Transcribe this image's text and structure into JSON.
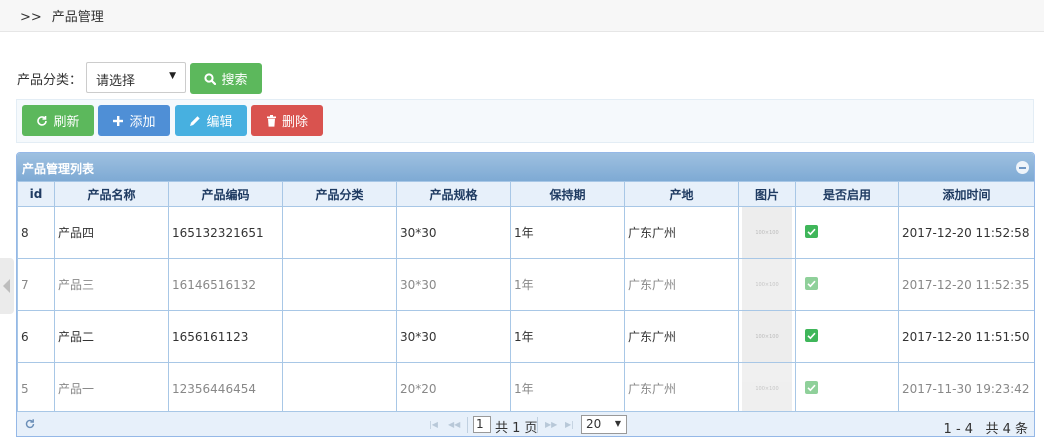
{
  "breadcrumb": {
    "prefix": ">>",
    "current": "产品管理"
  },
  "filter": {
    "label": "产品分类：",
    "select_value": "请选择",
    "search_label": "搜索"
  },
  "toolbar": {
    "refresh": "刷新",
    "add": "添加",
    "edit": "编辑",
    "delete": "删除"
  },
  "grid": {
    "title": "产品管理列表",
    "columns": [
      "id",
      "产品名称",
      "产品编码",
      "产品分类",
      "产品规格",
      "保持期",
      "产地",
      "图片",
      "是否启用",
      "添加时间"
    ],
    "rows": [
      {
        "id": "8",
        "name": "产品四",
        "code": "165132321651",
        "category": "",
        "spec": "30*30",
        "shelf": "1年",
        "origin": "广东广州",
        "image": "100×100",
        "enabled": true,
        "time": "2017-12-20 11:52:58"
      },
      {
        "id": "7",
        "name": "产品三",
        "code": "16146516132",
        "category": "",
        "spec": "30*30",
        "shelf": "1年",
        "origin": "广东广州",
        "image": "100×100",
        "enabled": true,
        "time": "2017-12-20 11:52:35"
      },
      {
        "id": "6",
        "name": "产品二",
        "code": "1656161123",
        "category": "",
        "spec": "30*30",
        "shelf": "1年",
        "origin": "广东广州",
        "image": "100×100",
        "enabled": true,
        "time": "2017-12-20 11:51:50"
      },
      {
        "id": "5",
        "name": "产品一",
        "code": "12356446454",
        "category": "",
        "spec": "20*20",
        "shelf": "1年",
        "origin": "广东广州",
        "image": "100×100",
        "enabled": true,
        "time": "2017-11-30 19:23:42"
      }
    ]
  },
  "pager": {
    "page": "1",
    "total_pages_text": "共 1 页",
    "page_size": "20",
    "range": "1 - 4",
    "total": "共 4 条"
  },
  "colors": {
    "green": "#5cb85c",
    "blue": "#4f8fd6",
    "cyan": "#47b0e0",
    "red": "#d9534f",
    "header": "#e7f0fa",
    "title_bar": "#7eaad4"
  }
}
